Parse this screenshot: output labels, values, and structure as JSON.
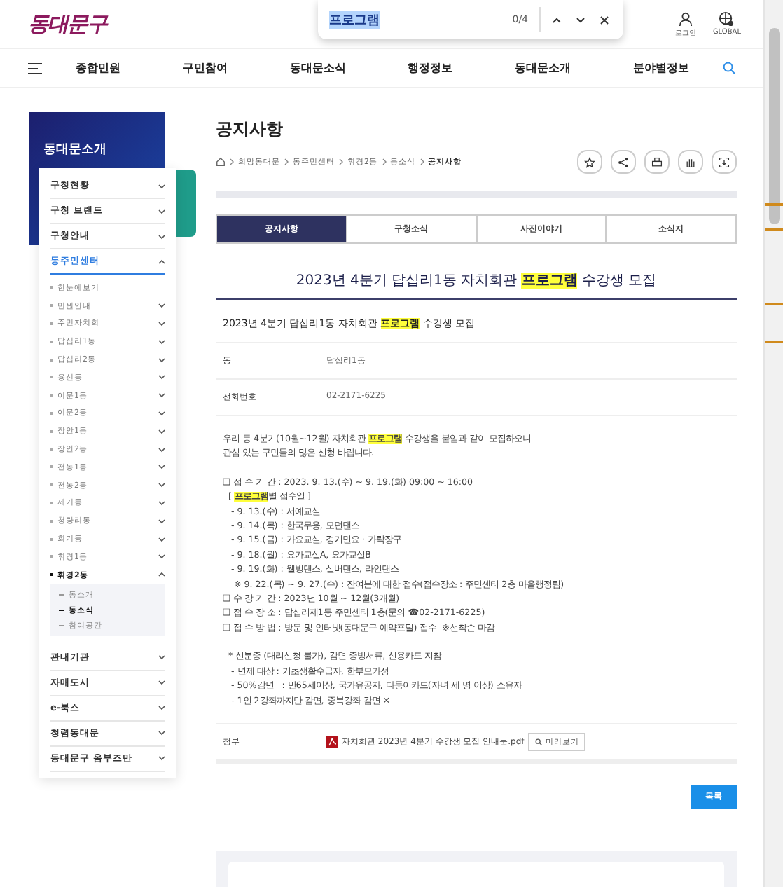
{
  "header": {
    "logo": "동대문구",
    "login": "로그인",
    "global": "GLOBAL"
  },
  "find_bar": {
    "value": "프로그램",
    "count": "0/4"
  },
  "nav": [
    "종합민원",
    "구민참여",
    "동대문소식",
    "행정정보",
    "동대문소개",
    "분야별정보"
  ],
  "sidebar": {
    "title": "동대문소개",
    "items": [
      {
        "label": "구청현황",
        "selected": false,
        "expanded": false
      },
      {
        "label": "구청 브랜드",
        "selected": false,
        "expanded": false
      },
      {
        "label": "구청안내",
        "selected": false,
        "expanded": false
      },
      {
        "label": "동주민센터",
        "selected": true,
        "expanded": true,
        "children": [
          {
            "label": "한눈에보기",
            "selected": false,
            "expanded": false,
            "has_arrow": false
          },
          {
            "label": "민원안내",
            "selected": false,
            "expanded": false,
            "has_arrow": true
          },
          {
            "label": "주민자치회",
            "selected": false,
            "expanded": false,
            "has_arrow": true
          },
          {
            "label": "답십리1동",
            "selected": false,
            "expanded": false,
            "has_arrow": true
          },
          {
            "label": "답십리2동",
            "selected": false,
            "expanded": false,
            "has_arrow": true
          },
          {
            "label": "용신동",
            "selected": false,
            "expanded": false,
            "has_arrow": true
          },
          {
            "label": "이문1동",
            "selected": false,
            "expanded": false,
            "has_arrow": true
          },
          {
            "label": "이문2동",
            "selected": false,
            "expanded": false,
            "has_arrow": true
          },
          {
            "label": "장안1동",
            "selected": false,
            "expanded": false,
            "has_arrow": true
          },
          {
            "label": "장안2동",
            "selected": false,
            "expanded": false,
            "has_arrow": true
          },
          {
            "label": "전농1동",
            "selected": false,
            "expanded": false,
            "has_arrow": true
          },
          {
            "label": "전농2동",
            "selected": false,
            "expanded": false,
            "has_arrow": true
          },
          {
            "label": "제기동",
            "selected": false,
            "expanded": false,
            "has_arrow": true
          },
          {
            "label": "청량리동",
            "selected": false,
            "expanded": false,
            "has_arrow": true
          },
          {
            "label": "회기동",
            "selected": false,
            "expanded": false,
            "has_arrow": true
          },
          {
            "label": "휘경1동",
            "selected": false,
            "expanded": false,
            "has_arrow": true
          },
          {
            "label": "휘경2동",
            "selected": true,
            "expanded": true,
            "has_arrow": true,
            "children": [
              {
                "label": "동소개",
                "selected": false
              },
              {
                "label": "동소식",
                "selected": true
              },
              {
                "label": "참여공간",
                "selected": false
              }
            ]
          }
        ]
      },
      {
        "label": "관내기관",
        "selected": false,
        "expanded": false
      },
      {
        "label": "자매도시",
        "selected": false,
        "expanded": false
      },
      {
        "label": "e-북스",
        "selected": false,
        "expanded": false
      },
      {
        "label": "청렴동대문",
        "selected": false,
        "expanded": false
      },
      {
        "label": "동대문구 옴부즈만",
        "selected": false,
        "expanded": false
      }
    ]
  },
  "page_title": "공지사항",
  "breadcrumb": [
    "희망동대문",
    "동주민센터",
    "휘경2동",
    "동소식",
    "공지사항"
  ],
  "tabs": [
    {
      "label": "공지사항",
      "selected": true
    },
    {
      "label": "구청소식",
      "selected": false
    },
    {
      "label": "사진이야기",
      "selected": false
    },
    {
      "label": "소식지",
      "selected": false
    }
  ],
  "post": {
    "title": [
      {
        "text": "2023년 4분기 답십리1동 자치회관 ",
        "highlight": false
      },
      {
        "text": "프로그램",
        "highlight": true
      },
      {
        "text": " 수강생 모집",
        "highlight": false
      }
    ],
    "subject": [
      {
        "text": "2023년 4분기 답십리1동 자치회관 ",
        "highlight": false
      },
      {
        "text": "프로그램",
        "highlight": true
      },
      {
        "text": " 수강생 모집",
        "highlight": false
      }
    ],
    "fields": [
      {
        "label": "동",
        "value": "답십리1동"
      },
      {
        "label": "전화번호",
        "value": "02-2171-6225"
      }
    ],
    "body": [
      [
        [
          {
            "text": "우리 동 4분기(10월~12월) 자치회관 ",
            "highlight": false
          },
          {
            "text": "프로그램",
            "highlight": true
          },
          {
            "text": " 수강생을 붙임과 같이 모집하오니",
            "highlight": false
          }
        ],
        [
          {
            "text": "관심 있는 구민들의 많은 신청 바랍니다.",
            "highlight": false
          }
        ]
      ],
      [
        [
          {
            "text": "❑ 접 수 기 간 : 2023. 9. 13.(수) ~ 9. 19.(화) 09:00 ~ 16:00",
            "highlight": false
          }
        ],
        [
          {
            "text": "  [ ",
            "highlight": false
          },
          {
            "text": "프로그램",
            "highlight": true
          },
          {
            "text": "별 접수일 ]",
            "highlight": false
          }
        ],
        [
          {
            "text": "   - 9. 13.(수) : 서예교실",
            "highlight": false
          }
        ],
        [
          {
            "text": "   - 9. 14.(목) : 한국무용, 모던댄스",
            "highlight": false
          }
        ],
        [
          {
            "text": "   - 9. 15.(금) : 가요교실, 경기민요 · 가락장구",
            "highlight": false
          }
        ],
        [
          {
            "text": "   - 9. 18.(월) : 요가교실A, 요가교실B",
            "highlight": false
          }
        ],
        [
          {
            "text": "   - 9. 19.(화) : 웰빙댄스, 실버댄스, 라인댄스",
            "highlight": false
          }
        ],
        [
          {
            "text": "    ※ 9. 22.(목) ~ 9. 27.(수) : 잔여분에 대한 접수(접수장소 : 주민센터 2층 마을행정팀)",
            "highlight": false
          }
        ],
        [
          {
            "text": "❑ 수 강 기 간 : 2023년 10월 ~ 12월(3개월)",
            "highlight": false
          }
        ],
        [
          {
            "text": "❑ 접 수 장 소 : 답십리제1동 주민센터 1층(문의 ☎02-2171-6225)",
            "highlight": false
          }
        ],
        [
          {
            "text": "❑ 접 수 방 법 : 방문 및 인터넷(동대문구 예약포털) 접수  ※선착순 마감",
            "highlight": false
          }
        ]
      ],
      [
        [
          {
            "text": "  * 신분증 (대리신청 불가), 감면 증빙서류, 신용카드 지참",
            "highlight": false
          }
        ],
        [
          {
            "text": "   - 면제 대상 : 기초생활수급자, 한부모가정",
            "highlight": false
          }
        ],
        [
          {
            "text": "   - 50%감면   : 만65세이상, 국가유공자, 다둥이카드(자녀 세 명 이상) 소유자",
            "highlight": false
          }
        ],
        [
          {
            "text": "   - 1인 2강좌까지만 감면, 중복강좌 감면 ✕",
            "highlight": false
          }
        ]
      ]
    ],
    "attachment": {
      "label": "첨부",
      "file": "자치회관 2023년 4분기 수강생 모집 안내문.pdf",
      "preview": "미리보기"
    },
    "list_button": "목록"
  }
}
